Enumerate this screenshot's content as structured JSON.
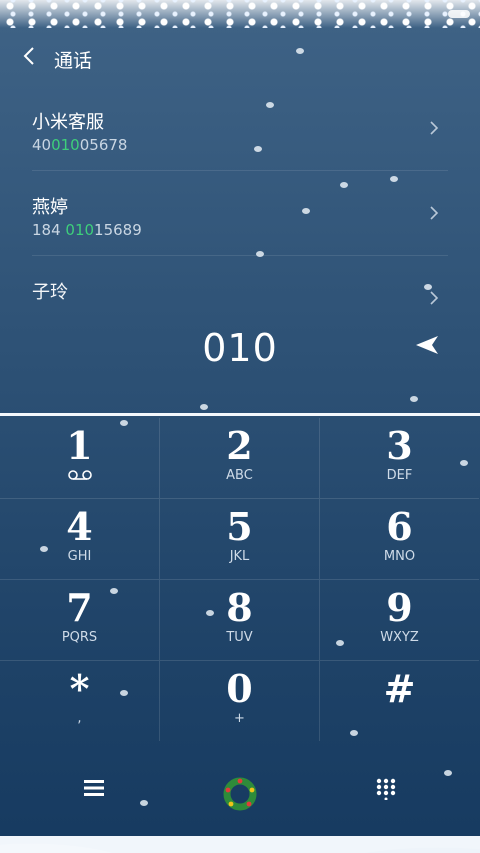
{
  "header": {
    "title": "通话"
  },
  "contacts": [
    {
      "name": "小米客服",
      "num_pre": "40",
      "num_hl": "010",
      "num_post": "05678"
    },
    {
      "name": "燕婷",
      "num_pre": "184 ",
      "num_hl": "010",
      "num_post": "15689"
    },
    {
      "name": "子玲"
    }
  ],
  "dialer": {
    "number": "010"
  },
  "keys": [
    {
      "digit": "1",
      "letters": ""
    },
    {
      "digit": "2",
      "letters": "ABC"
    },
    {
      "digit": "3",
      "letters": "DEF"
    },
    {
      "digit": "4",
      "letters": "GHI"
    },
    {
      "digit": "5",
      "letters": "JKL"
    },
    {
      "digit": "6",
      "letters": "MNO"
    },
    {
      "digit": "7",
      "letters": "PQRS"
    },
    {
      "digit": "8",
      "letters": "TUV"
    },
    {
      "digit": "9",
      "letters": "WXYZ"
    },
    {
      "digit": "*",
      "letters": ","
    },
    {
      "digit": "0",
      "letters": "+"
    },
    {
      "digit": "#",
      "letters": ""
    }
  ],
  "icons": {
    "back": "back-arrow-icon",
    "send": "send-arrow-icon",
    "voicemail": "voicemail-icon",
    "menu": "menu-icon",
    "wreath": "wreath-icon",
    "keypad": "keypad-grid-icon"
  },
  "colors": {
    "highlight": "#3ecf7b",
    "background": "#2e5276"
  }
}
